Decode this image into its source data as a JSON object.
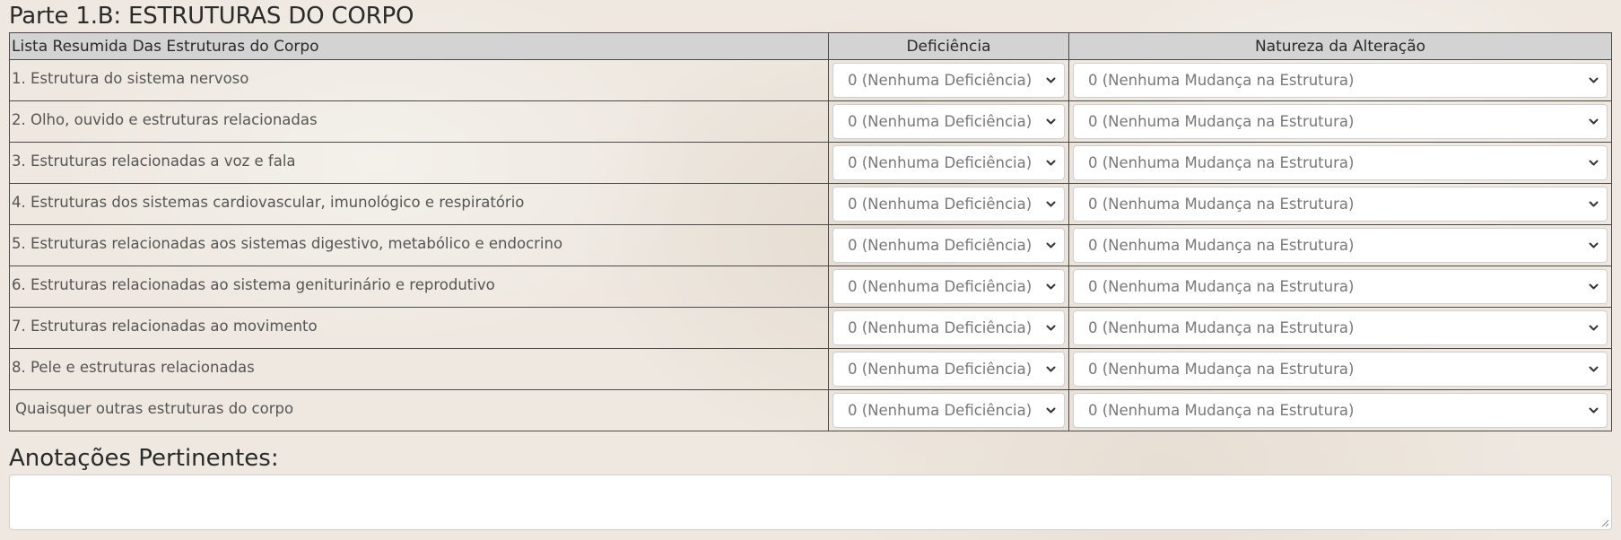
{
  "section": {
    "title": "Parte 1.B: ESTRUTURAS DO CORPO"
  },
  "table": {
    "headers": {
      "list": "Lista Resumida Das Estruturas do Corpo",
      "deficiency": "Deficiência",
      "nature": "Natureza da Alteração"
    },
    "rows": [
      {
        "label": "1. Estrutura do sistema nervoso",
        "deficiency": "0 (Nenhuma Deficiência)",
        "nature": "0 (Nenhuma Mudança na Estrutura)"
      },
      {
        "label": "2. Olho, ouvido e estruturas relacionadas",
        "deficiency": "0 (Nenhuma Deficiência)",
        "nature": "0 (Nenhuma Mudança na Estrutura)"
      },
      {
        "label": "3. Estruturas relacionadas a voz e fala",
        "deficiency": "0 (Nenhuma Deficiência)",
        "nature": "0 (Nenhuma Mudança na Estrutura)"
      },
      {
        "label": "4. Estruturas dos sistemas cardiovascular, imunológico e respiratório",
        "deficiency": "0 (Nenhuma Deficiência)",
        "nature": "0 (Nenhuma Mudança na Estrutura)"
      },
      {
        "label": "5. Estruturas relacionadas aos sistemas digestivo, metabólico e endocrino",
        "deficiency": "0 (Nenhuma Deficiência)",
        "nature": "0 (Nenhuma Mudança na Estrutura)"
      },
      {
        "label": "6. Estruturas relacionadas ao sistema geniturinário  e reprodutivo",
        "deficiency": "0 (Nenhuma Deficiência)",
        "nature": "0 (Nenhuma Mudança na Estrutura)"
      },
      {
        "label": "7. Estruturas relacionadas ao movimento",
        "deficiency": "0 (Nenhuma Deficiência)",
        "nature": "0 (Nenhuma Mudança na Estrutura)"
      },
      {
        "label": "8. Pele e estruturas relacionadas",
        "deficiency": "0 (Nenhuma Deficiência)",
        "nature": "0 (Nenhuma Mudança na Estrutura)"
      },
      {
        "label": "Quaisquer outras estruturas do corpo",
        "deficiency": "0 (Nenhuma Deficiência)",
        "nature": "0 (Nenhuma Mudança na Estrutura)"
      }
    ]
  },
  "notes": {
    "title": "Anotações Pertinentes:",
    "value": ""
  }
}
